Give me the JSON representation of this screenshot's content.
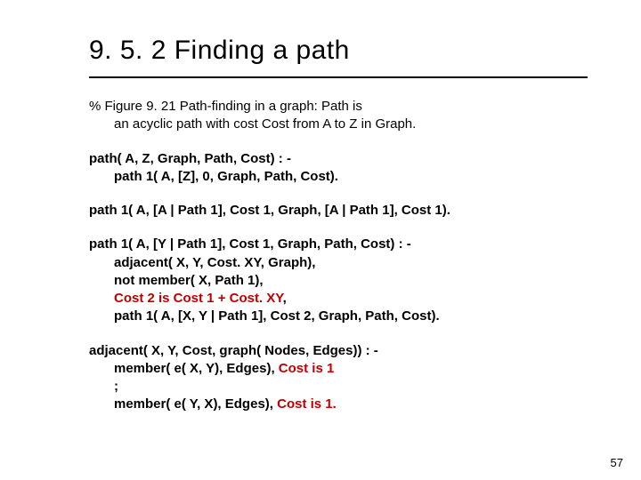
{
  "title": "9. 5. 2 Finding a path",
  "comment": {
    "l1": "% Figure 9. 21   Path-finding in a graph:  Path is",
    "l2": "an acyclic path with cost Cost from A to Z in Graph."
  },
  "path_head": "path( A, Z, Graph, Path, Cost)  : -",
  "path_body": "path 1( A, [Z], 0, Graph, Path, Cost).",
  "path1a": "path 1( A, [A | Path 1], Cost 1, Graph, [A | Path 1], Cost 1).",
  "path1b_head": "path 1( A, [Y | Path 1], Cost 1, Graph, Path, Cost)  : -",
  "path1b_l1": "adjacent( X, Y, Cost. XY, Graph),",
  "path1b_l2": "not member( X, Path 1),",
  "path1b_l3_red": "Cost 2 is Cost 1 + Cost. XY",
  "path1b_l3_tail": ",",
  "path1b_l4": "path 1( A, [X, Y | Path 1], Cost 2, Graph, Path, Cost).",
  "adj_head": "adjacent( X, Y, Cost, graph( Nodes, Edges))  : -",
  "adj_l1a": "member( e( X, Y), Edges), ",
  "adj_l1r": "Cost is 1",
  "adj_l2": ";",
  "adj_l3a": "member( e( Y, X), Edges), ",
  "adj_l3r": "Cost is 1.",
  "pagenum": "57"
}
